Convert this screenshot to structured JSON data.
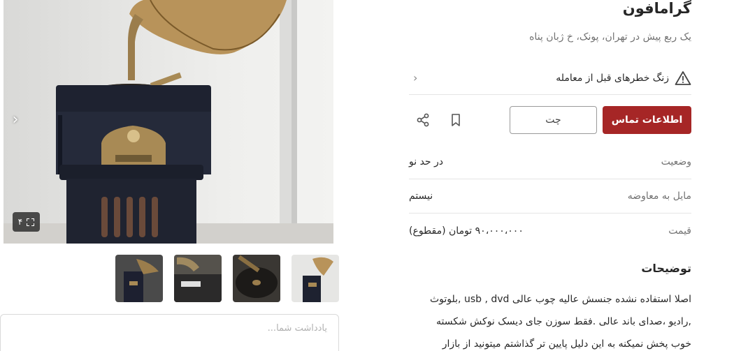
{
  "gallery": {
    "image_count": "۴",
    "next_icon": "chevron-right-icon",
    "thumbnail_count": 4
  },
  "note": {
    "placeholder": "یادداشت شما..."
  },
  "listing": {
    "title": "گرامافون",
    "subtitle": "یک ربع پیش در تهران، پونک، خ ژبان پناه",
    "warning": "زنگ خطرهای قبل از معامله",
    "contact_button": "اطلاعات تماس",
    "chat_button": "چت",
    "accent_color": "#a62626",
    "details": [
      {
        "key": "وضعیت",
        "value": "در حد نو"
      },
      {
        "key": "مایل به معاوضه",
        "value": "نیستم"
      },
      {
        "key": "قیمت",
        "value": "۹۰،۰۰۰،۰۰۰ تومان (مقطوع)"
      }
    ],
    "description_title": "توضیحات",
    "description_lines": [
      "اصلا استفاده نشده جنسش عالیه چوب عالی usb , dvd ,بلوتوث",
      ",رادیو ،صدای باند عالی .فقط سوزن جای دیسک نوکش شکسته",
      "خوب پخش نمیکنه به این دلیل پایین تر گذاشتم میتونید از بازار"
    ]
  }
}
